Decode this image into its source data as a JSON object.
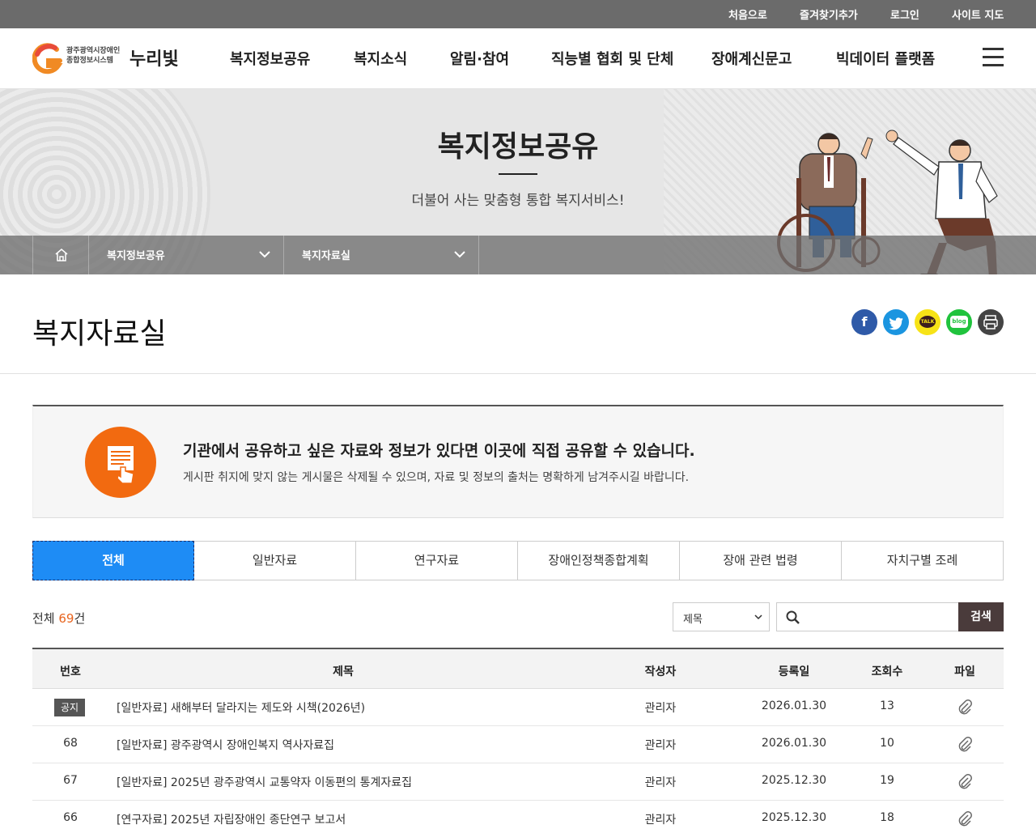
{
  "topbar": {
    "links": [
      "처음으로",
      "즐겨찾기추가",
      "로그인",
      "사이트 지도"
    ]
  },
  "logo": {
    "sub_line1": "광주광역시장애인",
    "sub_line2": "종합정보시스템",
    "main": "누리빛"
  },
  "gnb": {
    "items": [
      "복지정보공유",
      "복지소식",
      "알림·참여",
      "직능별 협회 및 단체",
      "장애계신문고",
      "빅데이터 플랫폼"
    ]
  },
  "visual": {
    "title": "복지정보공유",
    "subtitle": "더불어 사는 맞춤형 통합 복지서비스!"
  },
  "location": {
    "depth1": "복지정보공유",
    "depth2": "복지자료실"
  },
  "page": {
    "title": "복지자료실"
  },
  "share": {
    "facebook": "f",
    "twitter": "t",
    "kakao": "TALK",
    "blog": "blog",
    "print": "print"
  },
  "info": {
    "heading": "기관에서 공유하고 싶은 자료와 정보가 있다면 이곳에 직접 공유할 수 있습니다.",
    "text": "게시판 취지에 맞지 않는 게시물은 삭제될 수 있으며, 자료 및 정보의 출처는 명확하게 남겨주시길 바랍니다."
  },
  "tabs": [
    "전체",
    "일반자료",
    "연구자료",
    "장애인정책종합계획",
    "장애 관련 법령",
    "자치구별 조례"
  ],
  "list": {
    "count_prefix": "전체 ",
    "count": "69",
    "count_suffix": "건",
    "search_select": "제목",
    "search_placeholder": "",
    "search_button": "검색"
  },
  "table": {
    "headers": [
      "번호",
      "제목",
      "작성자",
      "등록일",
      "조회수",
      "파일"
    ],
    "rows": [
      {
        "no": "공지",
        "title": "[일반자료] 새해부터 달라지는 제도와 시책(2026년)",
        "author": "관리자",
        "date": "2026.01.30",
        "views": "13"
      },
      {
        "no": "68",
        "title": "[일반자료] 광주광역시 장애인복지 역사자료집",
        "author": "관리자",
        "date": "2026.01.30",
        "views": "10"
      },
      {
        "no": "67",
        "title": "[일반자료] 2025년 광주광역시 교통약자 이동편의 통계자료집",
        "author": "관리자",
        "date": "2025.12.30",
        "views": "19"
      },
      {
        "no": "66",
        "title": "[연구자료] 2025년 자립장애인 종단연구 보고서",
        "author": "관리자",
        "date": "2025.12.30",
        "views": "18"
      }
    ]
  },
  "colors": {
    "accent_tab": "#1e8cf5",
    "orange": "#f26a10",
    "count_highlight": "#e8641e",
    "search_button": "#4a3b3b"
  }
}
